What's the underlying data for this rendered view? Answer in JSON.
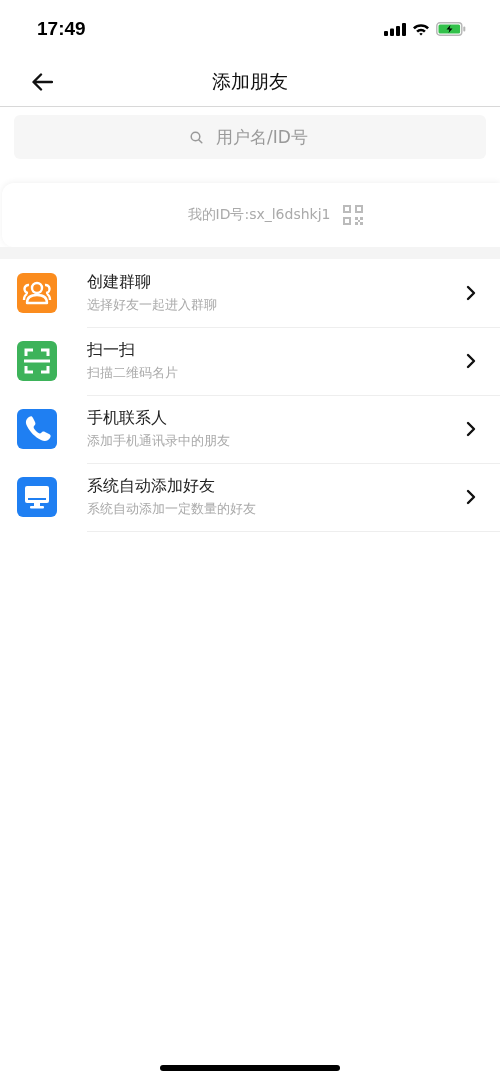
{
  "status_bar": {
    "time": "17:49"
  },
  "nav": {
    "title": "添加朋友"
  },
  "search": {
    "placeholder": "用户名/ID号"
  },
  "my_id": {
    "text": "我的ID号:sx_l6dshkj1"
  },
  "items": [
    {
      "kind": "group",
      "color": "#fb8c1e",
      "title": "创建群聊",
      "subtitle": "选择好友一起进入群聊"
    },
    {
      "kind": "scan",
      "color": "#3db35a",
      "title": "扫一扫",
      "subtitle": "扫描二维码名片"
    },
    {
      "kind": "phone",
      "color": "#1f7ff2",
      "title": "手机联系人",
      "subtitle": "添加手机通讯录中的朋友"
    },
    {
      "kind": "monitor",
      "color": "#1f7ff2",
      "title": "系统自动添加好友",
      "subtitle": "系统自动添加一定数量的好友"
    }
  ]
}
